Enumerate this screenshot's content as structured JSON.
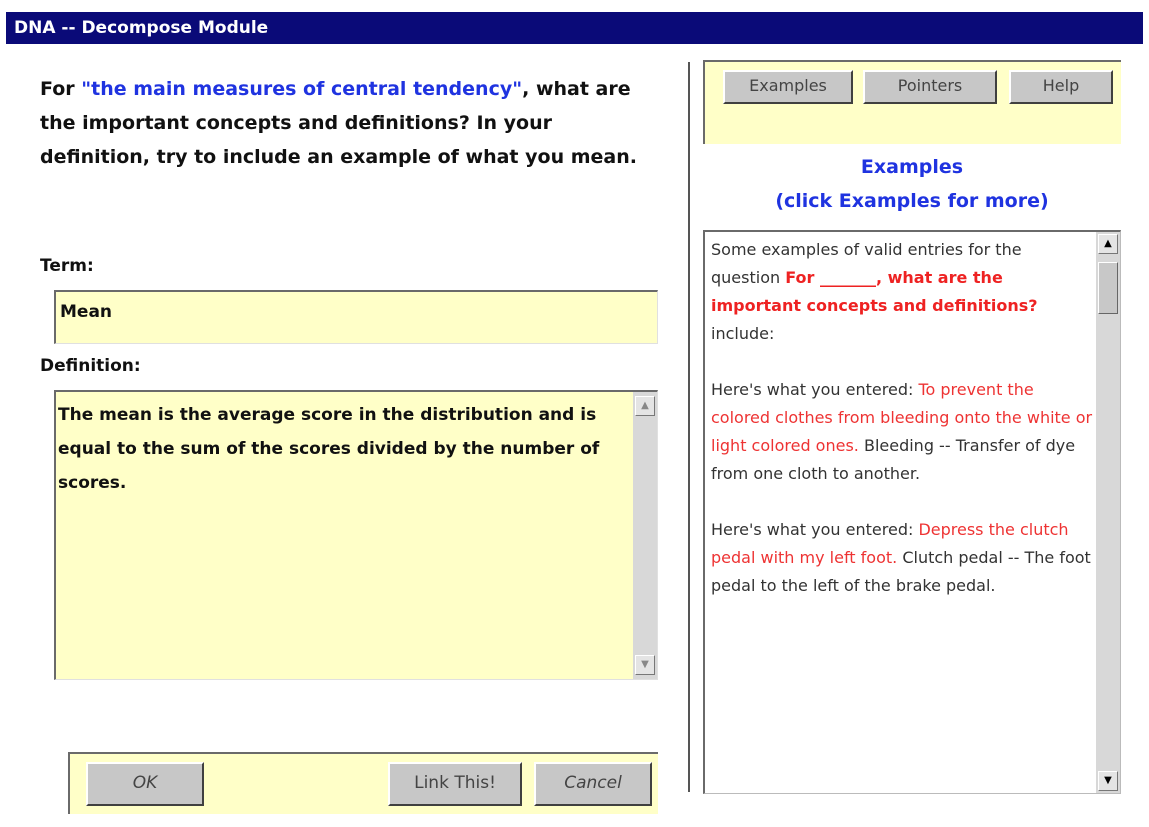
{
  "window": {
    "title": "DNA -- Decompose Module"
  },
  "prompt": {
    "before": "For ",
    "topic": "\"the main measures of central tendency\"",
    "after": ", what are the important concepts and definitions? In your definition, try to include an example of what you mean."
  },
  "term": {
    "label": "Term:",
    "value": "Mean"
  },
  "definition": {
    "label": "Definition:",
    "value": "The mean is the average score in the distribution and is equal to the sum of the scores divided by the number of scores."
  },
  "buttons": {
    "ok": "OK",
    "link": "Link This!",
    "cancel": "Cancel"
  },
  "toolbar": {
    "examples": "Examples",
    "pointers": "Pointers",
    "help": "Help"
  },
  "examples_panel": {
    "heading": "Examples",
    "subheading": "(click Examples for more)",
    "intro_before": "Some examples of valid entries for the question ",
    "intro_question": "For _______, what are the important concepts and definitions?",
    "intro_after": " include:",
    "entries": [
      {
        "prefix": "Here's what you entered: ",
        "entered": "To prevent the colored clothes from bleeding onto the white or light colored ones.",
        "response": " Bleeding -- Transfer of dye from one cloth to another."
      },
      {
        "prefix": "Here's what you entered: ",
        "entered": "Depress the clutch pedal with my left foot.",
        "response": " Clutch pedal -- The foot pedal to the left of the brake pedal."
      }
    ]
  },
  "colors": {
    "titlebar": "#0a0a78",
    "field_bg": "#ffffc8",
    "topic_blue": "#1f33e0",
    "example_red": "#ee2222"
  }
}
